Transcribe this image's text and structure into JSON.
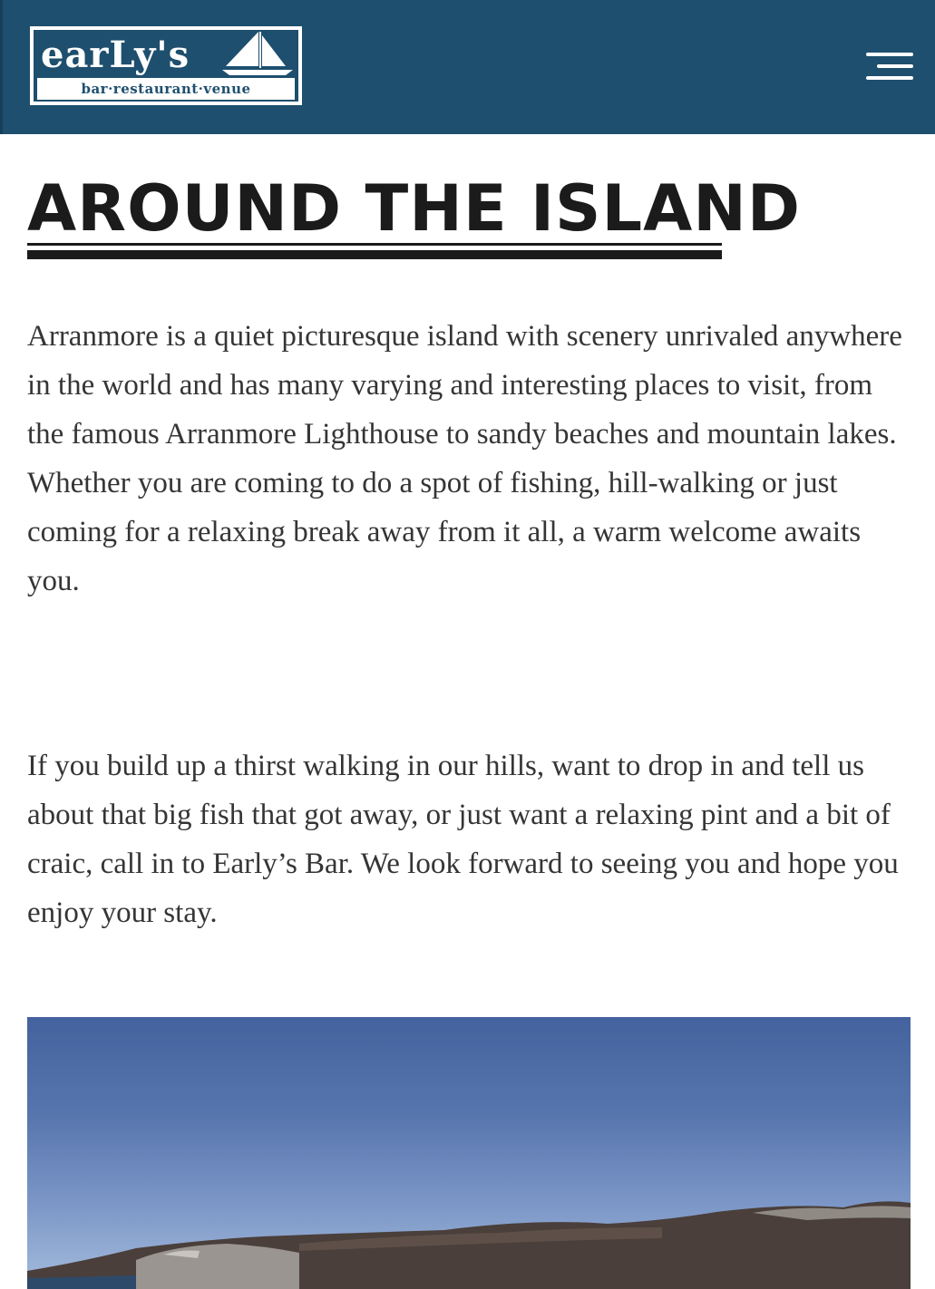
{
  "header": {
    "logo": {
      "name": "earLy's",
      "tagline": "bar·restaurant·venue",
      "icon": "sailboat-icon"
    },
    "menu_icon": "hamburger-menu-icon"
  },
  "main": {
    "title": "AROUND THE ISLAND",
    "paragraphs": [
      "Arranmore is a quiet picturesque island with scenery unrivaled anywhere in the world and has many varying and interesting places to visit, from the famous Arranmore Lighthouse to sandy beaches and mountain lakes. Whether you are coming to do a spot of fishing, hill-walking or just coming for a relaxing break away from it all, a warm welcome awaits you.",
      "If you build up a thirst walking in our hills, want to drop in and tell us about that big fish that got away, or just want a relaxing pint and a bit of craic, call in to Early’s Bar. We look forward to seeing you and hope you enjoy your stay."
    ],
    "photo": {
      "subject": "island-landscape-photo"
    }
  },
  "colors": {
    "header_bg": "#1e4f6e",
    "text": "#353535",
    "title": "#1b1b1b"
  }
}
